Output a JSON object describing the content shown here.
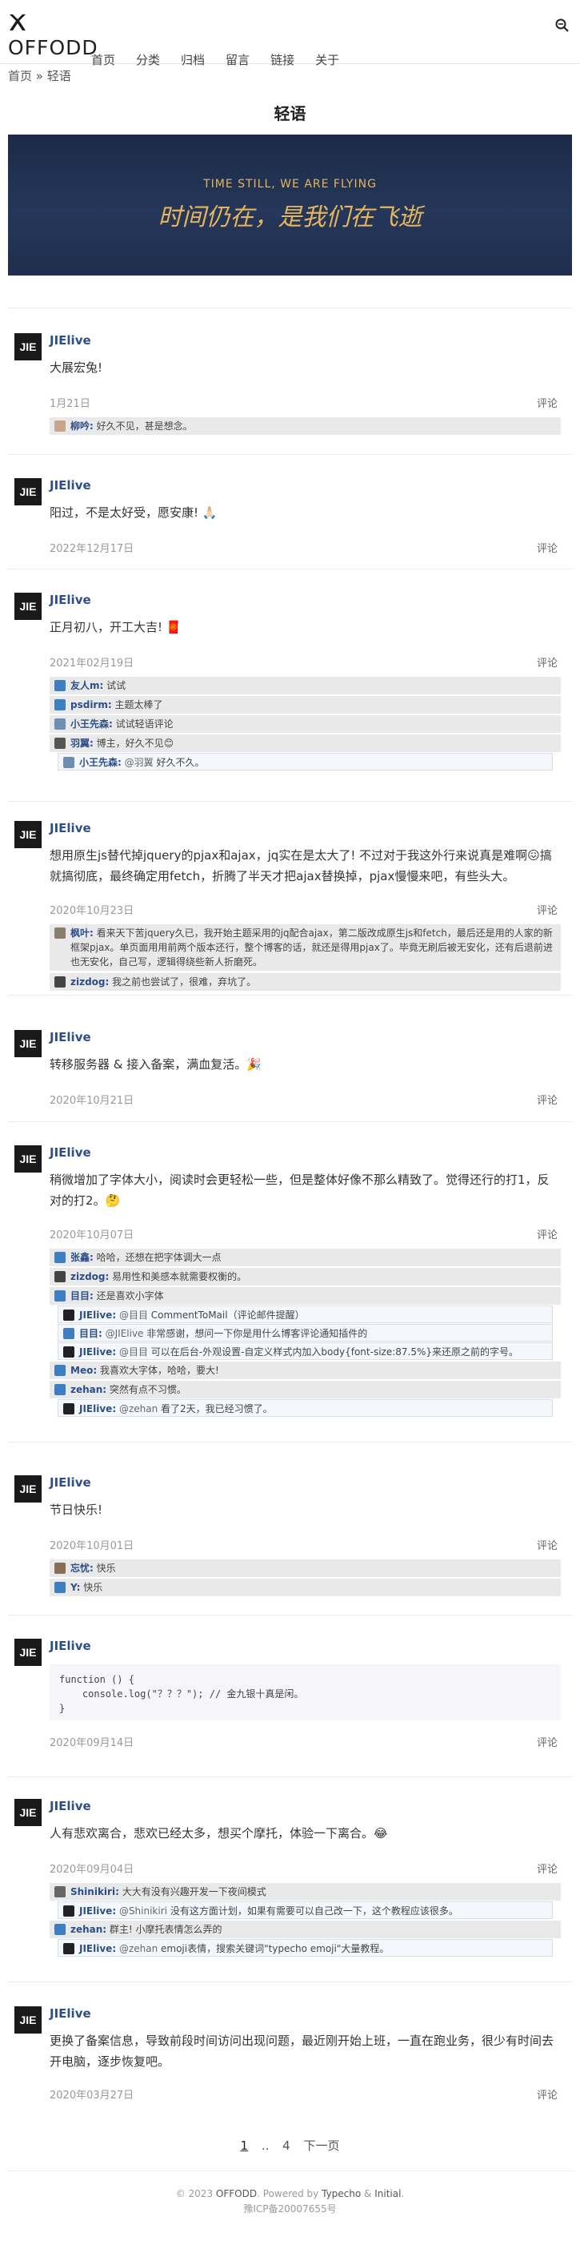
{
  "site": {
    "name": "OFFODD"
  },
  "nav": [
    "首页",
    "分类",
    "归档",
    "留言",
    "链接",
    "关于"
  ],
  "breadcrumb": {
    "home": "首页",
    "sep": " » ",
    "current": "轻语"
  },
  "page_title": "轻语",
  "banner": {
    "en": "TIME STILL, WE ARE FLYING",
    "cn": "时间仍在，是我们在飞逝"
  },
  "posts": [
    {
      "author": "JIElive",
      "content": "大展宏兔!",
      "date": "1月21日",
      "comment_label": "评论",
      "comments": [
        {
          "name": "柳吟:",
          "text": " 好久不见，甚是想念。"
        }
      ]
    },
    {
      "author": "JIElive",
      "content": "阳过，不是太好受，愿安康! 🙏🏻",
      "date": "2022年12月17日",
      "comment_label": "评论",
      "comments": []
    },
    {
      "author": "JIElive",
      "content": "正月初八，开工大吉! 🧧",
      "date": "2021年02月19日",
      "comment_label": "评论",
      "comments": [
        {
          "name": "友人m:",
          "text": " 试试"
        },
        {
          "name": "psdirm:",
          "text": " 主题太棒了"
        },
        {
          "name": "小王先森:",
          "text": " 试试轻语评论"
        },
        {
          "name": "羽翼:",
          "text": " 博主，好久不见😊"
        },
        {
          "name": "小王先森:",
          "to": " @羽翼",
          "text": " 好久不久。"
        }
      ]
    },
    {
      "author": "JIElive",
      "content": "想用原生js替代掉jquery的pjax和ajax，jq实在是太大了! 不过对于我这外行来说真是难啊😖搞就搞彻底，最终确定用fetch，折腾了半天才把ajax替换掉，pjax慢慢来吧，有些头大。",
      "date": "2020年10月23日",
      "comment_label": "评论",
      "comments": [
        {
          "name": "枫叶:",
          "text": " 看来天下苦jquery久已，我开始主题采用的jq配合ajax，第二版改成原生js和fetch，最后还是用的人家的新框架pjax。单页面用用前两个版本还行，整个博客的话，就还是得用pjax了。毕竟无刷后被无安化，还有后退前进也无安化，自己写，逻辑得绕些新人折磨死。"
        },
        {
          "name": "zizdog:",
          "text": " 我之前也尝试了，很难，弃坑了。"
        }
      ]
    },
    {
      "author": "JIElive",
      "content": "转移服务器 & 接入备案，满血复活。🎉",
      "date": "2020年10月21日",
      "comment_label": "评论",
      "comments": []
    },
    {
      "author": "JIElive",
      "content": "稍微增加了字体大小，阅读时会更轻松一些，但是整体好像不那么精致了。觉得还行的打1，反对的打2。🤔",
      "date": "2020年10月07日",
      "comment_label": "评论",
      "comments": [
        {
          "name": "张鑫:",
          "text": " 哈哈，还想在把字体调大一点"
        },
        {
          "name": "zizdog:",
          "text": " 易用性和美感本就需要权衡的。"
        },
        {
          "name": "目目:",
          "text": " 还是喜欢小字体"
        },
        {
          "name": "JIElive:",
          "to": " @目目",
          "text": " CommentToMail（评论邮件提醒）"
        },
        {
          "name": "目目:",
          "to": " @JIElive",
          "text": " 非常感谢，想问一下你是用什么博客评论通知插件的"
        },
        {
          "name": "JIElive:",
          "to": " @目目",
          "text": " 可以在后台-外观设置-自定义样式内加入body{font-size:87.5%}来还原之前的字号。"
        },
        {
          "name": "Meo:",
          "text": " 我喜欢大字体，哈哈，要大!"
        },
        {
          "name": "zehan:",
          "text": " 突然有点不习惯。"
        },
        {
          "name": "JIElive:",
          "to": " @zehan",
          "text": " 看了2天，我已经习惯了。"
        }
      ]
    },
    {
      "author": "JIElive",
      "content": "节日快乐!",
      "date": "2020年10月01日",
      "comment_label": "评论",
      "comments": [
        {
          "name": "忘忧:",
          "text": " 快乐"
        },
        {
          "name": "Y:",
          "text": " 快乐"
        }
      ]
    },
    {
      "author": "JIElive",
      "code": "function () {\n    console.log(\"？？？\"); // 金九银十真是闲。\n}",
      "date": "2020年09月14日",
      "comment_label": "评论",
      "comments": []
    },
    {
      "author": "JIElive",
      "content": "人有悲欢离合，悲欢已经太多，想买个摩托，体验一下离合。😂",
      "date": "2020年09月04日",
      "comment_label": "评论",
      "comments": [
        {
          "name": "Shinikiri:",
          "text": " 大大有没有兴趣开发一下夜间模式"
        },
        {
          "name": "JIElive:",
          "to": " @Shinikiri",
          "text": " 没有这方面计划，如果有需要可以自己改一下，这个教程应该很多。"
        },
        {
          "name": "zehan:",
          "text": " 群主! 小摩托表情怎么弄的"
        },
        {
          "name": "JIElive:",
          "to": " @zehan",
          "text": " emoji表情，搜索关键词\"typecho emoji\"大量教程。"
        }
      ]
    },
    {
      "author": "JIElive",
      "content": "更换了备案信息，导致前段时间访问出现问题，最近刚开始上班，一直在跑业务，很少有时间去开电脑，逐步恢复吧。",
      "date": "2020年03月27日",
      "comment_label": "评论",
      "comments": []
    }
  ],
  "pager": {
    "current": "1",
    "ellipsis": "..",
    "last": "4",
    "next": "下一页"
  },
  "footer": {
    "copy": "© 2023",
    "site": "OFFODD",
    "powered": ". Powered by",
    "typecho": "Typecho",
    "amp": "&",
    "initial": "Initial",
    "dot": ".",
    "icp": "豫ICP备20007655号"
  }
}
